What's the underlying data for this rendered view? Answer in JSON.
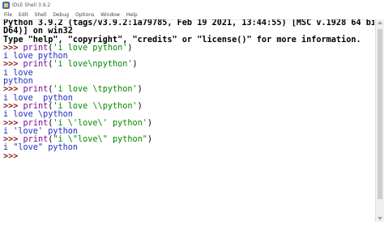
{
  "window": {
    "title": "IDLE Shell 3.9.2"
  },
  "menu": [
    "File",
    "Edit",
    "Shell",
    "Debug",
    "Options",
    "Window",
    "Help"
  ],
  "shell": {
    "banner": [
      "Python 3.9.2 (tags/v3.9.2:1a79785, Feb 19 2021, 13:44:55) [MSC v.1928 64 bit (AM",
      "D64)] on win32",
      "Type \"help\", \"copyright\", \"credits\" or \"license()\" for more information."
    ],
    "prompt": ">>>",
    "entries": [
      {
        "kw": "print",
        "open": "(",
        "str": "'i love python'",
        "close": ")",
        "output": [
          "i love python"
        ]
      },
      {
        "kw": "print",
        "open": "(",
        "str": "'i love\\npython'",
        "close": ")",
        "output": [
          "i love",
          "python"
        ]
      },
      {
        "kw": "print",
        "open": "(",
        "str": "'i love \\tpython'",
        "close": ")",
        "output": [
          "i love  python"
        ]
      },
      {
        "kw": "print",
        "open": "(",
        "str": "'i love \\\\python'",
        "close": ")",
        "output": [
          "i love \\python"
        ]
      },
      {
        "kw": "print",
        "open": "(",
        "str": "'i \\'love\\' python'",
        "close": ")",
        "output": [
          "i 'love' python"
        ]
      },
      {
        "kw": "print",
        "open": "(",
        "str": "\"i \\\"love\\\" python\"",
        "close": ")",
        "output": [
          "i \"love\" python"
        ]
      }
    ]
  },
  "colors": {
    "prompt": "#8b1d1d",
    "keyword": "#7a0e91",
    "string": "#008a00",
    "output": "#1f2dbf"
  }
}
